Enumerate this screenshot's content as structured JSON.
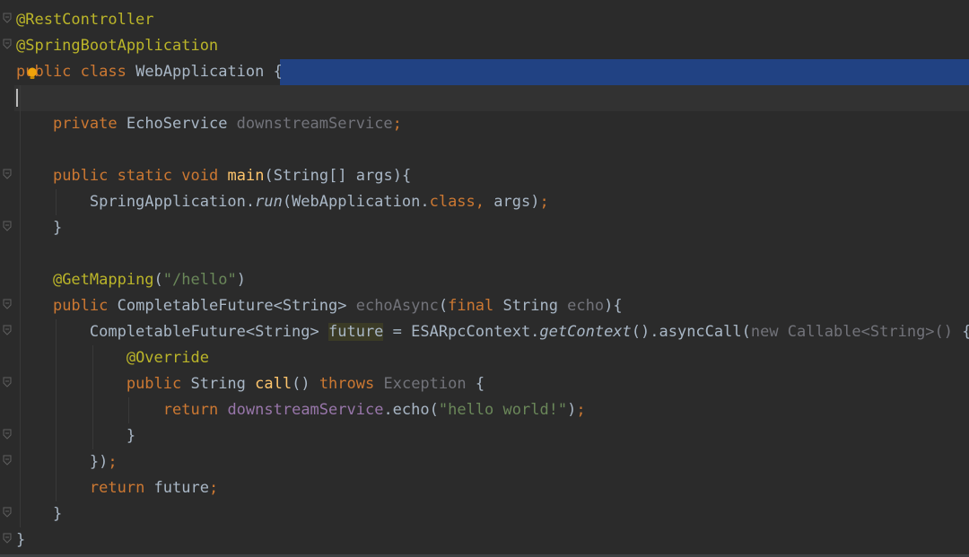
{
  "editor": {
    "language": "java",
    "colors": {
      "background": "#2b2b2b",
      "keyword": "#cc7832",
      "annotation": "#bbb529",
      "field": "#9876aa",
      "string": "#6a8759",
      "method_decl": "#ffc66d",
      "plain": "#a9b7c6",
      "selection": "#214283"
    },
    "lines": [
      {
        "tokens": [
          {
            "t": "@RestController",
            "c": "ann"
          }
        ]
      },
      {
        "tokens": [
          {
            "t": "@SpringBootApplication",
            "c": "ann"
          }
        ]
      },
      {
        "tokens": [
          {
            "t": "public",
            "c": "kw"
          },
          {
            "t": " "
          },
          {
            "t": "class",
            "c": "kw"
          },
          {
            "t": " WebApplication {"
          }
        ]
      },
      {
        "tokens": []
      },
      {
        "tokens": [
          {
            "t": "    "
          },
          {
            "t": "private",
            "c": "kw"
          },
          {
            "t": " EchoService "
          },
          {
            "t": "downstreamService",
            "c": "unused"
          },
          {
            "t": ";",
            "c": "kw"
          }
        ]
      },
      {
        "tokens": []
      },
      {
        "tokens": [
          {
            "t": "    "
          },
          {
            "t": "public",
            "c": "kw"
          },
          {
            "t": " "
          },
          {
            "t": "static",
            "c": "kw"
          },
          {
            "t": " "
          },
          {
            "t": "void",
            "c": "kw"
          },
          {
            "t": " "
          },
          {
            "t": "main",
            "c": "fn"
          },
          {
            "t": "(String[] args){"
          }
        ]
      },
      {
        "tokens": [
          {
            "t": "        SpringApplication."
          },
          {
            "t": "run",
            "c": "it"
          },
          {
            "t": "(WebApplication."
          },
          {
            "t": "class",
            "c": "kw"
          },
          {
            "t": ", ",
            "c": "kw"
          },
          {
            "t": "args)"
          },
          {
            "t": ";",
            "c": "kw"
          }
        ]
      },
      {
        "tokens": [
          {
            "t": "    }"
          }
        ]
      },
      {
        "tokens": []
      },
      {
        "tokens": [
          {
            "t": "    "
          },
          {
            "t": "@GetMapping",
            "c": "ann"
          },
          {
            "t": "("
          },
          {
            "t": "\"/hello\"",
            "c": "str"
          },
          {
            "t": ")"
          }
        ]
      },
      {
        "tokens": [
          {
            "t": "    "
          },
          {
            "t": "public",
            "c": "kw"
          },
          {
            "t": " CompletableFuture<String> "
          },
          {
            "t": "echoAsync",
            "c": "unused"
          },
          {
            "t": "("
          },
          {
            "t": "final",
            "c": "kw"
          },
          {
            "t": " String "
          },
          {
            "t": "echo",
            "c": "unused"
          },
          {
            "t": "){"
          }
        ]
      },
      {
        "tokens": [
          {
            "t": "        CompletableFuture<String> "
          },
          {
            "t": "future",
            "c": "hl"
          },
          {
            "t": " = ESARpcContext."
          },
          {
            "t": "getContext",
            "c": "it"
          },
          {
            "t": "().asyncCall("
          },
          {
            "t": "new Callable<String>() ",
            "c": "unused"
          },
          {
            "t": "{"
          }
        ]
      },
      {
        "tokens": [
          {
            "t": "            "
          },
          {
            "t": "@Override",
            "c": "ann"
          }
        ]
      },
      {
        "tokens": [
          {
            "t": "            "
          },
          {
            "t": "public",
            "c": "kw"
          },
          {
            "t": " String "
          },
          {
            "t": "call",
            "c": "fn"
          },
          {
            "t": "() "
          },
          {
            "t": "throws",
            "c": "kw"
          },
          {
            "t": " "
          },
          {
            "t": "Exception",
            "c": "unused"
          },
          {
            "t": " {"
          }
        ]
      },
      {
        "tokens": [
          {
            "t": "                "
          },
          {
            "t": "return",
            "c": "kw"
          },
          {
            "t": " "
          },
          {
            "t": "downstreamService",
            "c": "fld"
          },
          {
            "t": ".echo("
          },
          {
            "t": "\"hello world!\"",
            "c": "str"
          },
          {
            "t": ")"
          },
          {
            "t": ";",
            "c": "kw"
          }
        ]
      },
      {
        "tokens": [
          {
            "t": "            }"
          }
        ]
      },
      {
        "tokens": [
          {
            "t": "        })"
          },
          {
            "t": ";",
            "c": "kw"
          }
        ]
      },
      {
        "tokens": [
          {
            "t": "        "
          },
          {
            "t": "return",
            "c": "kw"
          },
          {
            "t": " future"
          },
          {
            "t": ";",
            "c": "kw"
          }
        ]
      },
      {
        "tokens": [
          {
            "t": "    }"
          }
        ]
      },
      {
        "tokens": [
          {
            "t": "}"
          }
        ]
      }
    ],
    "fold_marker_lines": [
      0,
      1,
      6,
      8,
      11,
      12,
      14,
      16,
      17,
      19,
      20
    ],
    "cursor_line": 3,
    "selected_line": 2,
    "intention_icon": "lightbulb-icon"
  }
}
